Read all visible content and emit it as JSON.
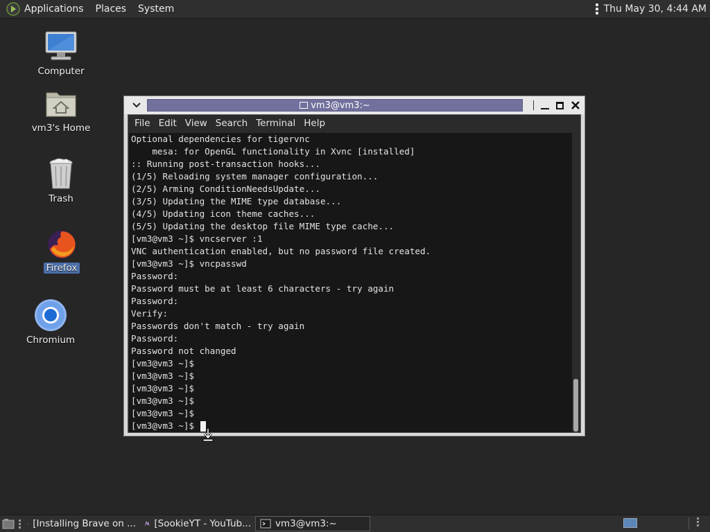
{
  "top_panel": {
    "menus": [
      "Applications",
      "Places",
      "System"
    ],
    "clock": "Thu May 30,  4:44 AM"
  },
  "desktop": {
    "icons": [
      {
        "label": "Computer"
      },
      {
        "label": "vm3's Home"
      },
      {
        "label": "Trash"
      },
      {
        "label": "Firefox"
      },
      {
        "label": "Chromium"
      }
    ]
  },
  "terminal": {
    "title": "vm3@vm3:~",
    "menu": [
      "File",
      "Edit",
      "View",
      "Search",
      "Terminal",
      "Help"
    ],
    "lines": [
      "Optional dependencies for tigervnc",
      "    mesa: for OpenGL functionality in Xvnc [installed]",
      ":: Running post-transaction hooks...",
      "(1/5) Reloading system manager configuration...",
      "(2/5) Arming ConditionNeedsUpdate...",
      "(3/5) Updating the MIME type database...",
      "(4/5) Updating icon theme caches...",
      "(5/5) Updating the desktop file MIME type cache...",
      "[vm3@vm3 ~]$ vncserver :1",
      "VNC authentication enabled, but no password file created.",
      "[vm3@vm3 ~]$ vncpasswd",
      "Password:",
      "Password must be at least 6 characters - try again",
      "Password:",
      "Verify:",
      "Passwords don't match - try again",
      "Password:",
      "Password not changed",
      "[vm3@vm3 ~]$",
      "[vm3@vm3 ~]$",
      "[vm3@vm3 ~]$",
      "[vm3@vm3 ~]$",
      "[vm3@vm3 ~]$",
      "[vm3@vm3 ~]$ "
    ]
  },
  "taskbar": {
    "tasks": [
      {
        "label": "[Installing Brave on ...",
        "icon": "chromium-icon"
      },
      {
        "label": "[SookieYT - YouTub...",
        "icon": "app-icon"
      },
      {
        "label": "vm3@vm3:~",
        "icon": "terminal-icon"
      }
    ]
  }
}
